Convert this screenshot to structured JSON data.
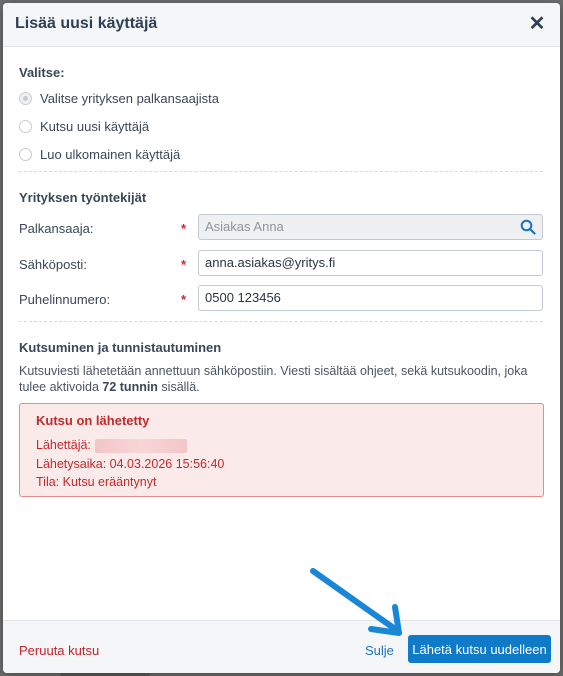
{
  "dialog": {
    "title": "Lisää uusi käyttäjä",
    "close_icon": "close-icon"
  },
  "choose": {
    "title": "Valitse:",
    "options": [
      {
        "label": "Valitse yrityksen palkansaajista",
        "selected": true
      },
      {
        "label": "Kutsu uusi käyttäjä",
        "selected": false
      },
      {
        "label": "Luo ulkomainen käyttäjä",
        "selected": false
      }
    ]
  },
  "employees": {
    "title": "Yrityksen työntekijät",
    "fields": {
      "payee": {
        "label": "Palkansaaja:",
        "value": "Asiakas Anna",
        "required": "*"
      },
      "email": {
        "label": "Sähköposti:",
        "value": "anna.asiakas@yritys.fi",
        "required": "*"
      },
      "phone": {
        "label": "Puhelinnumero:",
        "value": "0500 123456",
        "required": "*"
      }
    },
    "search_icon": "search-icon"
  },
  "invite": {
    "title": "Kutsuminen ja tunnistautuminen",
    "text_before": "Kutsuviesti lähetetään annettuun sähköpostiin. Viesti sisältää ohjeet, sekä kutsukoodin, joka tulee aktivoida ",
    "text_bold": "72 tunnin",
    "text_after": " sisällä."
  },
  "alert": {
    "title": "Kutsu on lähetetty",
    "sender_label": "Lähettäjä:",
    "sent_time": "Lähetysaika: 04.03.2026 15:56:40",
    "status": "Tila: Kutsu erääntynyt",
    "color": "#c12a2a"
  },
  "footer": {
    "cancel_invite": "Peruuta kutsu",
    "close": "Sulje",
    "resend": "Lähetä kutsu uudelleen"
  },
  "colors": {
    "primary": "#0f7ac7",
    "danger": "#c0222e",
    "annotation_arrow": "#1a86d6"
  }
}
